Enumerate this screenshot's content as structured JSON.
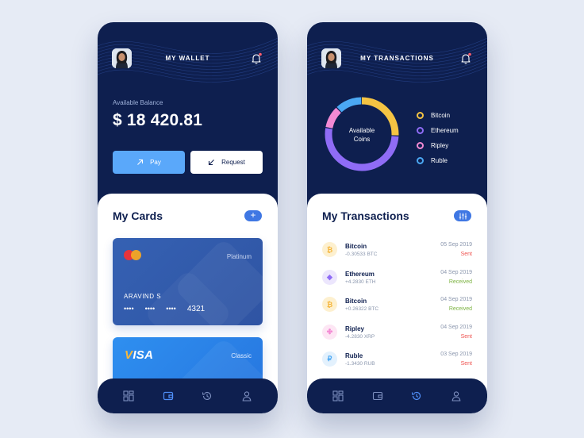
{
  "wallet": {
    "title": "MY WALLET",
    "balance_label": "Available Balance",
    "balance_value": "$ 18 420.81",
    "pay_label": "Pay",
    "request_label": "Request",
    "section_title": "My Cards",
    "add_symbol": "+",
    "cards": [
      {
        "type": "Platinum",
        "holder": "ARAVIND S",
        "masked": [
          "••••",
          "••••",
          "••••"
        ],
        "last4": "4321",
        "brand": "mastercard"
      },
      {
        "type": "Classic",
        "brand": "VISA"
      }
    ]
  },
  "transactions_screen": {
    "title": "MY TRANSACTIONS",
    "donut_center": [
      "Available",
      "Coins"
    ],
    "coins": [
      {
        "name": "Bitcoin",
        "color": "#f5c443",
        "share": 0.26
      },
      {
        "name": "Ethereum",
        "color": "#8f6cf6",
        "share": 0.52
      },
      {
        "name": "Ripley",
        "color": "#f38ad4",
        "share": 0.1
      },
      {
        "name": "Ruble",
        "color": "#4ba8f3",
        "share": 0.12
      }
    ],
    "section_title": "My Transactions",
    "transactions": [
      {
        "coin": "Bitcoin",
        "symbol": "₿",
        "amount": "-0.30533 BTC",
        "date": "05 Sep 2019",
        "status": "Sent",
        "icon_bg": "#fdf0cf",
        "icon_color": "#f5b53b"
      },
      {
        "coin": "Ethereum",
        "symbol": "◆",
        "amount": "+4.2830 ETH",
        "date": "04 Sep 2019",
        "status": "Received",
        "icon_bg": "#ece6fd",
        "icon_color": "#8f6cf6"
      },
      {
        "coin": "Bitcoin",
        "symbol": "₿",
        "amount": "+0.26322 BTC",
        "date": "04 Sep 2019",
        "status": "Received",
        "icon_bg": "#fdf0cf",
        "icon_color": "#f5b53b"
      },
      {
        "coin": "Ripley",
        "symbol": "✤",
        "amount": "-4.2830 XRP",
        "date": "04 Sep 2019",
        "status": "Sent",
        "icon_bg": "#fde6f4",
        "icon_color": "#f38ad4"
      },
      {
        "coin": "Ruble",
        "symbol": "₽",
        "amount": "-1.3430 RUB",
        "date": "03 Sep 2019",
        "status": "Sent",
        "icon_bg": "#e3f1fd",
        "icon_color": "#4ba8f3"
      }
    ]
  },
  "colors": {
    "navy": "#0e1f4f",
    "accent_blue": "#3f77e3",
    "sent": "#ef5350",
    "received": "#7cb342"
  },
  "nav_icons": [
    "dashboard-icon",
    "wallet-icon",
    "history-icon",
    "profile-icon"
  ]
}
